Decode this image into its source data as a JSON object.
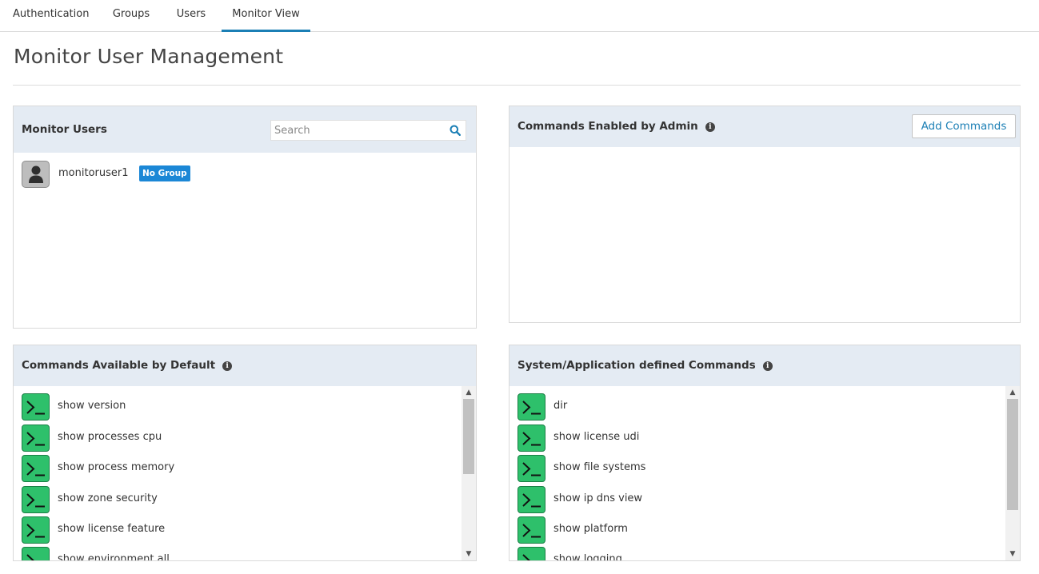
{
  "tabs": [
    {
      "label": "Authentication"
    },
    {
      "label": "Groups"
    },
    {
      "label": "Users"
    },
    {
      "label": "Monitor View",
      "active": true
    }
  ],
  "page": {
    "title": "Monitor User Management"
  },
  "monitor_users": {
    "title": "Monitor Users",
    "search_placeholder": "Search",
    "users": [
      {
        "name": "monitoruser1",
        "badge": "No Group"
      }
    ]
  },
  "admin_commands": {
    "title": "Commands Enabled by Admin",
    "add_button": "Add Commands",
    "commands": []
  },
  "default_commands": {
    "title": "Commands Available by Default",
    "commands": [
      "show version",
      "show processes cpu",
      "show process memory",
      "show zone security",
      "show license feature",
      "show environment all"
    ]
  },
  "system_commands": {
    "title": "System/Application defined Commands",
    "commands": [
      "dir",
      "show license udi",
      "show file systems",
      "show ip dns view",
      "show platform",
      "show logging"
    ]
  },
  "colors": {
    "accent": "#1b7fb5",
    "panel_header": "#e4ebf3",
    "badge": "#1b87d6",
    "terminal_icon": "#2ec06b"
  },
  "icons": {
    "search": "search-icon",
    "info": "info-icon",
    "user": "user-avatar-icon",
    "terminal": "terminal-icon"
  }
}
